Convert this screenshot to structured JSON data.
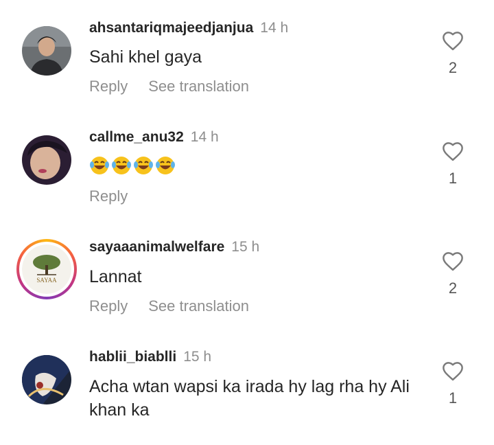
{
  "comments": [
    {
      "username": "ahsantariqmajeedjanjua",
      "time": "14 h",
      "text": "Sahi khel gaya",
      "reply_label": "Reply",
      "translate_label": "See translation",
      "likes": "2",
      "avatar_icon": "person-photo"
    },
    {
      "username": "callme_anu32",
      "time": "14 h",
      "text": "",
      "emojis": [
        "😂",
        "😂",
        "😂",
        "😂"
      ],
      "reply_label": "Reply",
      "likes": "1",
      "avatar_icon": "person-photo"
    },
    {
      "username": "sayaaanimalwelfare",
      "time": "15 h",
      "text": "Lannat",
      "reply_label": "Reply",
      "translate_label": "See translation",
      "likes": "2",
      "avatar_icon": "tree-logo"
    },
    {
      "username": "hablii_biablli",
      "time": "15 h",
      "text": "Acha wtan wapsi ka irada hy lag rha hy Ali khan ka",
      "reply_label": "Reply",
      "likes": "1",
      "avatar_icon": "person-photo"
    }
  ],
  "colors": {
    "text": "#262626",
    "secondary": "#8e8e8e",
    "story_ring_start": "#fdb913",
    "story_ring_end": "#c13584"
  }
}
